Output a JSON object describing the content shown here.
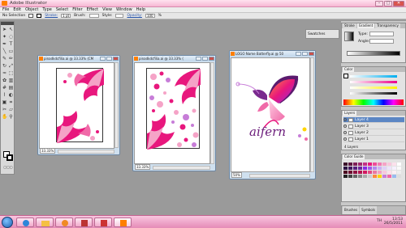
{
  "app": {
    "title": "Adobe Illustrator"
  },
  "menu": [
    "File",
    "Edit",
    "Object",
    "Type",
    "Select",
    "Filter",
    "Effect",
    "View",
    "Window",
    "Help"
  ],
  "control_bar": {
    "selection": "No Selection",
    "stroke_label": "Stroke:",
    "stroke_value": "1 pt",
    "brush_label": "Brush:",
    "style_label": "Style:",
    "opacity_label": "Opacity:",
    "opacity_value": "100",
    "opacity_unit": "%"
  },
  "documents": [
    {
      "title": "pinadkdcfilia.ai @ 33.33% (CM",
      "zoom": "33.33%"
    },
    {
      "title": "pinadkdcfilia.ai @ 33.33% (",
      "zoom": "33.33%"
    },
    {
      "title": "LOGO Name Batterfly.ai @ 50",
      "zoom": "50%"
    }
  ],
  "logo_text": "aifern",
  "panels": {
    "swatches_tab": "Swatches",
    "stroke_tabs": [
      "Stroke",
      "Gradient",
      "Transparency"
    ],
    "gradient_type_label": "Type:",
    "gradient_angle_label": "Angle:",
    "color_tab": "Color",
    "layers_tab": "Layers",
    "layers": [
      {
        "name": "Layer 4",
        "selected": true
      },
      {
        "name": "Layer 3",
        "selected": false
      },
      {
        "name": "Layer 2",
        "selected": false
      },
      {
        "name": "Layer 1",
        "selected": false
      }
    ],
    "layers_count": "4 Layers",
    "color_guide_tab": "Color Guide",
    "bottom_tabs": [
      "Brushes",
      "Symbols"
    ]
  },
  "taskbar": {
    "lang": "TH",
    "time": "13:53",
    "date": "26/5/2011"
  },
  "colors": {
    "accent_pink": "#e8177d",
    "light_pink": "#f5a3c7",
    "purple": "#8a2be2"
  }
}
